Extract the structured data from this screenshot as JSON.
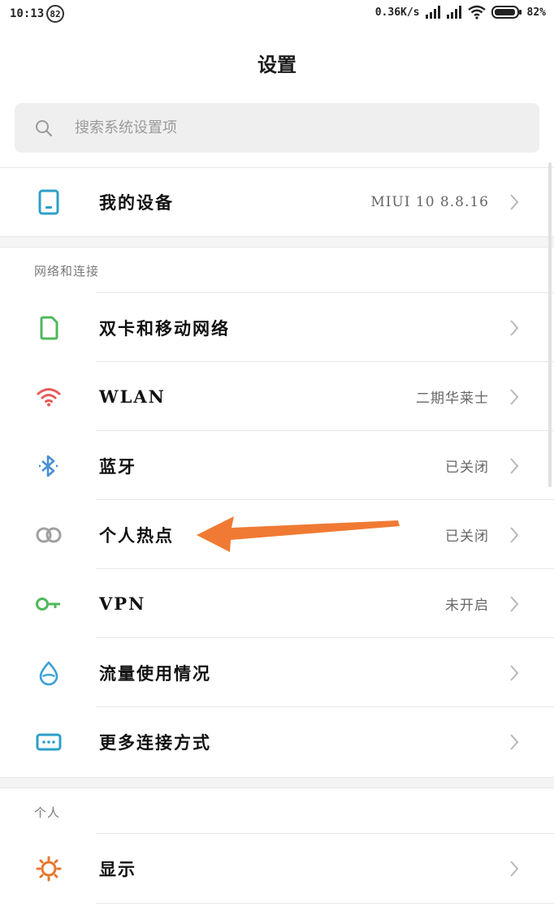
{
  "status_bar": {
    "time": "10:13",
    "notification_badge": "82",
    "network_speed": "0.36K/s",
    "battery_percent": "82%"
  },
  "header": {
    "title": "设置"
  },
  "search": {
    "placeholder": "搜索系统设置项"
  },
  "device_row": {
    "label": "我的设备",
    "value": "MIUI 10 8.8.16",
    "icon": "tablet-icon"
  },
  "sections": {
    "network": {
      "title": "网络和连接",
      "items": [
        {
          "label": "双卡和移动网络",
          "value": "",
          "icon": "sim-card-icon"
        },
        {
          "label": "WLAN",
          "value": "二期华莱士",
          "icon": "wifi-icon"
        },
        {
          "label": "蓝牙",
          "value": "已关闭",
          "icon": "bluetooth-icon"
        },
        {
          "label": "个人热点",
          "value": "已关闭",
          "icon": "hotspot-icon"
        },
        {
          "label": "VPN",
          "value": "未开启",
          "icon": "vpn-key-icon"
        },
        {
          "label": "流量使用情况",
          "value": "",
          "icon": "data-drop-icon"
        },
        {
          "label": "更多连接方式",
          "value": "",
          "icon": "more-connections-icon"
        }
      ]
    },
    "personal": {
      "title": "个人",
      "items": [
        {
          "label": "显示",
          "value": "",
          "icon": "display-sun-icon"
        }
      ]
    }
  },
  "colors": {
    "tablet": "#2c9fc9",
    "sim": "#4fb85a",
    "wifi": "#e85a5a",
    "bluetooth": "#4a8fd6",
    "hotspot": "#a0a0a0",
    "vpn": "#4fb85a",
    "data": "#3aa0d8",
    "more": "#2c9fc9",
    "display": "#e8762c",
    "arrow": "#f07a33"
  }
}
